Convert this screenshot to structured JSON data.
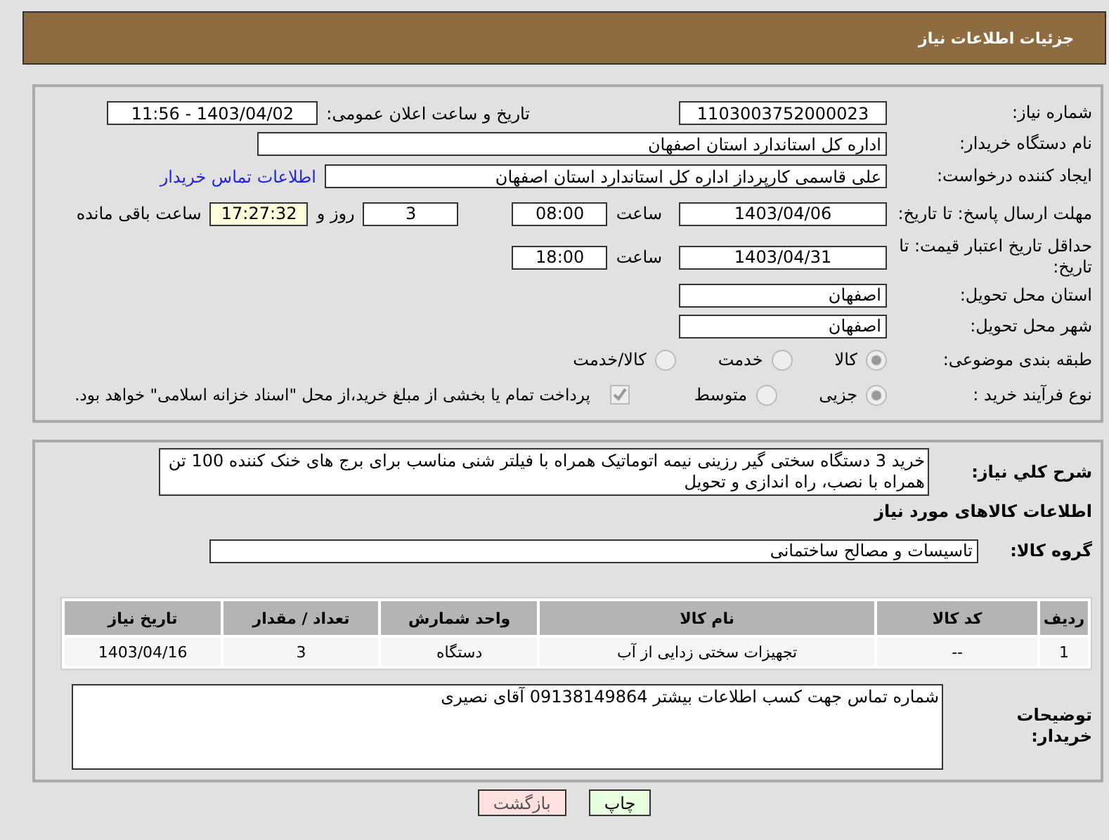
{
  "header": {
    "title": "جزئیات اطلاعات نیاز"
  },
  "fields": {
    "need_number": {
      "label": "شماره نیاز:",
      "value": "1103003752000023"
    },
    "announce": {
      "label": "تاریخ و ساعت اعلان عمومی:",
      "value": "1403/04/02 - 11:56"
    },
    "buyer_org": {
      "label": "نام دستگاه خریدار:",
      "value": "اداره کل استاندارد استان اصفهان"
    },
    "requester": {
      "label": "ایجاد کننده درخواست:",
      "value": "علی قاسمی کارپرداز اداره کل استاندارد استان اصفهان",
      "link": "اطلاعات تماس خریدار"
    },
    "reply_deadline": {
      "label": "مهلت ارسال پاسخ: تا تاریخ:",
      "date": "1403/04/06",
      "time_label": "ساعت",
      "time": "08:00",
      "days": "3",
      "days_label": "روز و",
      "remaining": "17:27:32",
      "remaining_label": "ساعت باقی مانده"
    },
    "price_validity": {
      "label": "حداقل تاریخ اعتبار قیمت: تا تاریخ:",
      "date": "1403/04/31",
      "time_label": "ساعت",
      "time": "18:00"
    },
    "province": {
      "label": "استان محل تحویل:",
      "value": "اصفهان"
    },
    "city": {
      "label": "شهر محل تحویل:",
      "value": "اصفهان"
    },
    "category": {
      "label": "طبقه بندی موضوعی:",
      "options": [
        {
          "label": "کالا",
          "selected": true
        },
        {
          "label": "خدمت",
          "selected": false
        },
        {
          "label": "کالا/خدمت",
          "selected": false
        }
      ]
    },
    "process": {
      "label": "نوع فرآیند خرید :",
      "options": [
        {
          "label": "جزیی",
          "selected": true
        },
        {
          "label": "متوسط",
          "selected": false
        }
      ],
      "payment": {
        "checked": true,
        "text": "پرداخت تمام یا بخشی از مبلغ خرید،از محل \"اسناد خزانه اسلامی\" خواهد بود."
      }
    }
  },
  "description": {
    "label": "شرح کلي نیاز:",
    "value": "خرید 3 دستگاه سختی گیر رزینی نیمه اتوماتیک همراه با فیلتر شنی مناسب برای برج های خنک کننده 100 تن همراه با نصب، راه اندازی و تحویل"
  },
  "goods_title": "اطلاعات کالاهای مورد نیاز",
  "goods_group": {
    "label": "گروه کالا:",
    "value": "تاسیسات و مصالح ساختمانی"
  },
  "table": {
    "columns": [
      "ردیف",
      "کد کالا",
      "نام کالا",
      "واحد شمارش",
      "تعداد / مقدار",
      "تاریخ نیاز"
    ],
    "rows": [
      [
        "1",
        "--",
        "تجهیزات سختی زدایی از آب",
        "دستگاه",
        "3",
        "1403/04/16"
      ]
    ]
  },
  "buyer_notes": {
    "label": "توضیحات خریدار:",
    "value": "شماره تماس جهت کسب اطلاعات بیشتر 09138149864 آقای نصیری"
  },
  "buttons": [
    {
      "label": "چاپ",
      "kind": "print"
    },
    {
      "label": "بازگشت",
      "kind": "back"
    }
  ]
}
